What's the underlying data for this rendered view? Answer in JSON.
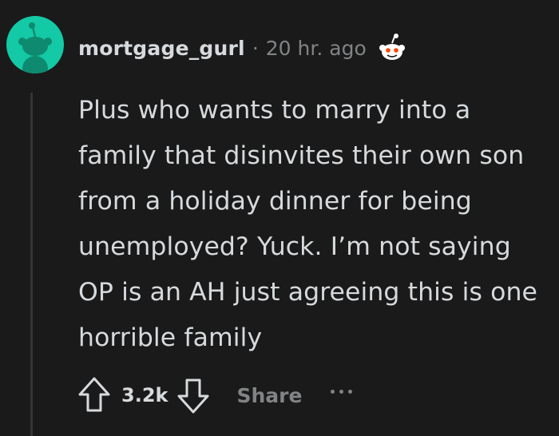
{
  "comment": {
    "author": "mortgage_gurl",
    "separator": "·",
    "timestamp": "20 hr. ago",
    "avatar_color": "#14c9a5",
    "flair_icon": "snoo-face-icon",
    "body": "Plus who wants to marry into a family that disinvites their own son from a holiday dinner for being unemployed? Yuck. I’m not saying OP is an AH just agreeing this is one horrible family"
  },
  "actions": {
    "upvote_icon": "upvote-arrow-icon",
    "score": "3.2k",
    "downvote_icon": "downvote-arrow-icon",
    "share_label": "Share",
    "more_icon": "more-options-icon"
  },
  "colors": {
    "background": "#1a1a1b",
    "text": "#d7dadc",
    "muted": "#818384",
    "thread_line": "#343536"
  }
}
